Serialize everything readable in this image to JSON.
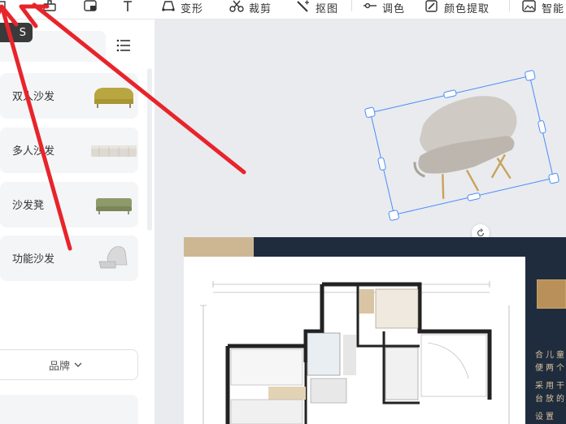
{
  "toolbar": {
    "items": [
      {
        "icon": "transform-icon",
        "label": "变形"
      },
      {
        "icon": "scissors-icon",
        "label": "裁剪"
      },
      {
        "icon": "magic-wand-icon",
        "label": "抠图"
      },
      {
        "icon": "adjust-slider-icon",
        "label": "调色"
      },
      {
        "icon": "eyedropper-icon",
        "label": "颜色提取"
      },
      {
        "icon": "image-icon",
        "label": "智能"
      }
    ]
  },
  "tooltip": {
    "text": "S"
  },
  "sidebar": {
    "categories": [
      {
        "label": "双人沙发"
      },
      {
        "label": "多人沙发"
      },
      {
        "label": "沙发凳"
      },
      {
        "label": "功能沙发"
      }
    ],
    "brand_filter": {
      "label": "品牌"
    }
  },
  "floorplan": {
    "text_lines": [
      "合儿童",
      "便两个",
      "采用干",
      "台放的",
      "设置"
    ]
  },
  "colors": {
    "accent": "#4a8cf7",
    "arrow": "#e8242b",
    "floorplan_bg": "#1f2c3d"
  }
}
